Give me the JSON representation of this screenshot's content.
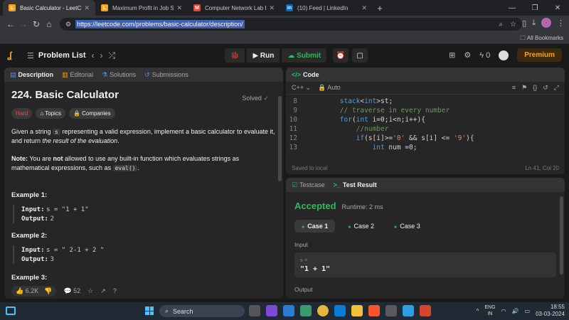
{
  "browser": {
    "tabs": [
      {
        "label": "Basic Calculator - LeetCode",
        "icon": "leetcode-icon",
        "color": "#ffa116",
        "glyph": "L",
        "active": true
      },
      {
        "label": "Maximum Profit in Job Schedul",
        "icon": "leetcode-icon",
        "color": "#ffa116",
        "glyph": "L",
        "active": false
      },
      {
        "label": "Computer Network Lab Experin",
        "icon": "gmail-icon",
        "color": "#ea4335",
        "glyph": "M",
        "active": false
      },
      {
        "label": "(10) Feed | LinkedIn",
        "icon": "linkedin-icon",
        "color": "#0a66c2",
        "glyph": "in",
        "active": false
      }
    ],
    "url": "https://leetcode.com/problems/basic-calculator/description/",
    "bookmarks_label": "All Bookmarks"
  },
  "lcnav": {
    "problem_list": "Problem List",
    "run_label": "Run",
    "submit_label": "Submit",
    "streak_count": "0",
    "premium_label": "Premium"
  },
  "left": {
    "tabs": {
      "description": "Description",
      "editorial": "Editorial",
      "solutions": "Solutions",
      "submissions": "Submissions"
    },
    "title": "224. Basic Calculator",
    "solved": "Solved",
    "tag_hard": "Hard",
    "tag_topics": "Topics",
    "tag_companies": "Companies",
    "para1_a": "Given a string ",
    "para1_code": "s",
    "para1_b": " representing a valid expression, implement a basic calculator to evaluate it, and return ",
    "para1_em": "the result of the evaluation",
    "para1_c": ".",
    "note_label": "Note:",
    "note_a": " You are ",
    "note_not": "not",
    "note_b": " allowed to use any built-in function which evaluates strings as mathematical expressions, such as ",
    "note_code": "eval()",
    "note_c": ".",
    "examples": [
      {
        "title": "Example 1:",
        "input": "s = \"1 + 1\"",
        "output": "2"
      },
      {
        "title": "Example 2:",
        "input": "s = \" 2-1 + 2 \"",
        "output": "3"
      }
    ],
    "example3_title": "Example 3:",
    "input_label": "Input:",
    "output_label": "Output:",
    "likes": "6.2K",
    "comments": "52"
  },
  "code": {
    "title": "Code",
    "language": "C++",
    "mode": "Auto",
    "lines": [
      {
        "n": "8",
        "t": "        stack<int>st;"
      },
      {
        "n": "9",
        "t": "        // traverse in every number"
      },
      {
        "n": "10",
        "t": "        for(int i=0;i<n;i++){"
      },
      {
        "n": "11",
        "t": "            //number"
      },
      {
        "n": "12",
        "t": "            if(s[i]>='0' && s[i] <= '9'){"
      },
      {
        "n": "13",
        "t": "                int num =0;"
      }
    ],
    "saved": "Saved to local",
    "position": "Ln 41, Col 20"
  },
  "test": {
    "tab_testcase": "Testcase",
    "tab_result": "Test Result",
    "status": "Accepted",
    "runtime": "Runtime: 2 ms",
    "cases": [
      "Case 1",
      "Case 2",
      "Case 3"
    ],
    "input_label": "Input",
    "var_name": "s =",
    "var_value": "\"1 + 1\"",
    "output_label": "Output"
  },
  "taskbar": {
    "search": "Search",
    "lang_top": "ENG",
    "lang_bottom": "IN",
    "time": "18:55",
    "date": "03-03-2024"
  }
}
